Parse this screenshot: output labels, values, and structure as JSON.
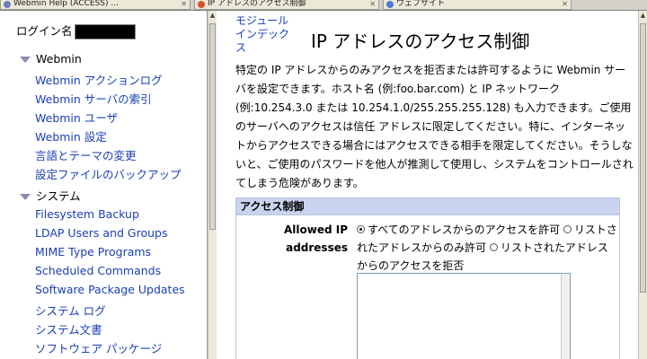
{
  "tabs": [
    {
      "title": "Webmin Help (ACCESS) ...",
      "icon": "webmin-icon"
    },
    {
      "title": "IP アドレスのアクセス制御",
      "icon": "firefox-icon"
    },
    {
      "title": "ウェブサイト",
      "icon": "page-icon"
    }
  ],
  "left": {
    "login_label": "ログイン名",
    "categories": [
      {
        "label": "Webmin",
        "items": [
          "Webmin アクションログ",
          "Webmin サーバの索引",
          "Webmin ユーザ",
          "Webmin 設定",
          "言語とテーマの変更",
          "設定ファイルのバックアップ"
        ]
      },
      {
        "label": "システム",
        "items": [
          "Filesystem Backup",
          "LDAP Users and Groups",
          "MIME Type Programs",
          "Scheduled Commands",
          "Software Package Updates",
          "システム ログ",
          "システム文書",
          "ソフトウェア パッケージ"
        ]
      }
    ]
  },
  "main": {
    "module_index": "モジュール インデックス",
    "title": "IP アドレスのアクセス制御",
    "description": "特定の IP アドレスからのみアクセスを拒否または許可するように Webmin サーバを設定できます。ホスト名 (例:foo.bar.com) と IP ネットワーク (例:10.254.3.0 または 10.254.1.0/255.255.255.128) も入力できます。ご使用のサーバへのアクセスは信任 アドレスに限定してください。特に、インターネットからアクセスできる場合にはアクセスできる相手を限定してください。そうしないと、ご使用のパスワードを他人が推測して使用し、システムをコントロールされてしまう危険があります。",
    "section_header": "アクセス制御",
    "field_label": "Allowed IP addresses",
    "options": [
      {
        "label": "すべてのアドレスからのアクセスを許可",
        "selected": true
      },
      {
        "label": "リストされたアドレスからのみ許可",
        "selected": false
      },
      {
        "label": "リストされたアドレスからのアクセスを拒否",
        "selected": false
      }
    ]
  }
}
